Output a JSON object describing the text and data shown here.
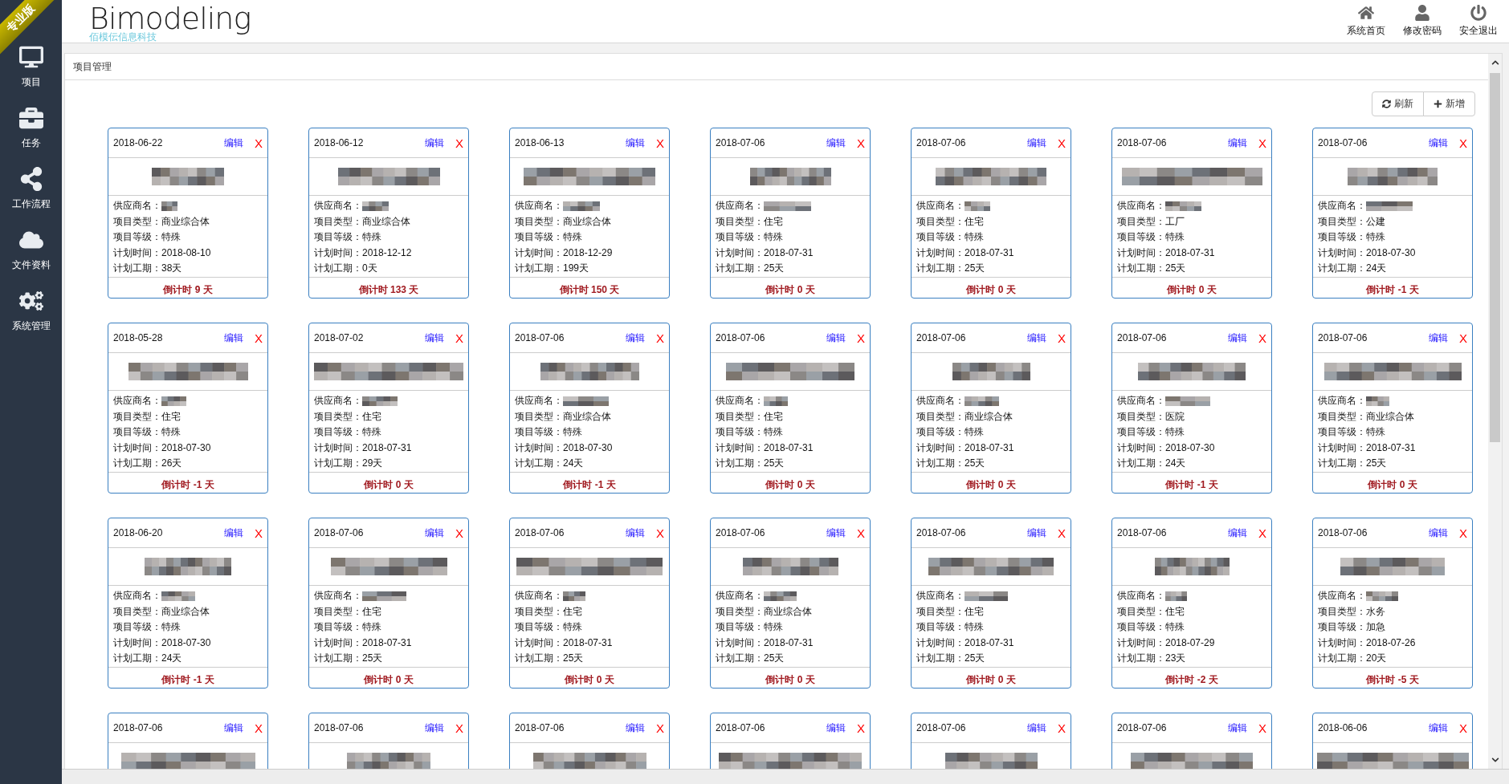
{
  "edition_ribbon": "专业版",
  "logo": {
    "name": "Bimodeling",
    "subtitle": "佰模伝信息科技"
  },
  "sidebar": {
    "items": [
      {
        "label": "项目"
      },
      {
        "label": "任务"
      },
      {
        "label": "工作流程"
      },
      {
        "label": "文件资料"
      },
      {
        "label": "系统管理"
      }
    ]
  },
  "top_nav": [
    {
      "label": "系统首页"
    },
    {
      "label": "修改密码"
    },
    {
      "label": "安全退出"
    }
  ],
  "panel": {
    "title": "项目管理",
    "buttons": [
      {
        "label": "刷新"
      },
      {
        "label": "新增"
      }
    ]
  },
  "cards": [
    {
      "date": "2018-06-22",
      "edit": "编辑",
      "delete": "X",
      "supplier_label": "供应商名：",
      "lines": [
        "项目类型：商业综合体",
        "项目等级：特殊",
        "计划时间：2018-08-10",
        "计划工期：38天"
      ],
      "countdown": "倒计时 9 天"
    },
    {
      "date": "2018-06-12",
      "edit": "编辑",
      "delete": "X",
      "supplier_label": "供应商名：",
      "lines": [
        "项目类型：商业综合体",
        "项目等级：特殊",
        "计划时间：2018-12-12",
        "计划工期：0天"
      ],
      "countdown": "倒计时 133 天"
    },
    {
      "date": "2018-06-13",
      "edit": "编辑",
      "delete": "X",
      "supplier_label": "供应商名：",
      "lines": [
        "项目类型：商业综合体",
        "项目等级：特殊",
        "计划时间：2018-12-29",
        "计划工期：199天"
      ],
      "countdown": "倒计时 150 天"
    },
    {
      "date": "2018-07-06",
      "edit": "编辑",
      "delete": "X",
      "supplier_label": "供应商名：",
      "lines": [
        "项目类型：住宅",
        "项目等级：特殊",
        "计划时间：2018-07-31",
        "计划工期：25天"
      ],
      "countdown": "倒计时 0 天"
    },
    {
      "date": "2018-07-06",
      "edit": "编辑",
      "delete": "X",
      "supplier_label": "供应商名：",
      "lines": [
        "项目类型：住宅",
        "项目等级：特殊",
        "计划时间：2018-07-31",
        "计划工期：25天"
      ],
      "countdown": "倒计时 0 天"
    },
    {
      "date": "2018-07-06",
      "edit": "编辑",
      "delete": "X",
      "supplier_label": "供应商名：",
      "lines": [
        "项目类型：工厂",
        "项目等级：特殊",
        "计划时间：2018-07-31",
        "计划工期：25天"
      ],
      "countdown": "倒计时 0 天"
    },
    {
      "date": "2018-07-06",
      "edit": "编辑",
      "delete": "X",
      "supplier_label": "供应商名：",
      "lines": [
        "项目类型：公建",
        "项目等级：特殊",
        "计划时间：2018-07-30",
        "计划工期：24天"
      ],
      "countdown": "倒计时 -1 天"
    },
    {
      "date": "2018-05-28",
      "edit": "编辑",
      "delete": "X",
      "supplier_label": "供应商名：",
      "lines": [
        "项目类型：住宅",
        "项目等级：特殊",
        "计划时间：2018-07-30",
        "计划工期：26天"
      ],
      "countdown": "倒计时 -1 天"
    },
    {
      "date": "2018-07-02",
      "edit": "编辑",
      "delete": "X",
      "supplier_label": "供应商名：",
      "lines": [
        "项目类型：住宅",
        "项目等级：特殊",
        "计划时间：2018-07-31",
        "计划工期：29天"
      ],
      "countdown": "倒计时 0 天"
    },
    {
      "date": "2018-07-06",
      "edit": "编辑",
      "delete": "X",
      "supplier_label": "供应商名：",
      "lines": [
        "项目类型：商业综合体",
        "项目等级：特殊",
        "计划时间：2018-07-30",
        "计划工期：24天"
      ],
      "countdown": "倒计时 -1 天"
    },
    {
      "date": "2018-07-06",
      "edit": "编辑",
      "delete": "X",
      "supplier_label": "供应商名：",
      "lines": [
        "项目类型：住宅",
        "项目等级：特殊",
        "计划时间：2018-07-31",
        "计划工期：25天"
      ],
      "countdown": "倒计时 0 天"
    },
    {
      "date": "2018-07-06",
      "edit": "编辑",
      "delete": "X",
      "supplier_label": "供应商名：",
      "lines": [
        "项目类型：商业综合体",
        "项目等级：特殊",
        "计划时间：2018-07-31",
        "计划工期：25天"
      ],
      "countdown": "倒计时 0 天"
    },
    {
      "date": "2018-07-06",
      "edit": "编辑",
      "delete": "X",
      "supplier_label": "供应商名：",
      "lines": [
        "项目类型：医院",
        "项目等级：特殊",
        "计划时间：2018-07-30",
        "计划工期：24天"
      ],
      "countdown": "倒计时 -1 天"
    },
    {
      "date": "2018-07-06",
      "edit": "编辑",
      "delete": "X",
      "supplier_label": "供应商名：",
      "lines": [
        "项目类型：商业综合体",
        "项目等级：特殊",
        "计划时间：2018-07-31",
        "计划工期：25天"
      ],
      "countdown": "倒计时 0 天"
    },
    {
      "date": "2018-06-20",
      "edit": "编辑",
      "delete": "X",
      "supplier_label": "供应商名：",
      "lines": [
        "项目类型：商业综合体",
        "项目等级：特殊",
        "计划时间：2018-07-30",
        "计划工期：24天"
      ],
      "countdown": "倒计时 -1 天"
    },
    {
      "date": "2018-07-06",
      "edit": "编辑",
      "delete": "X",
      "supplier_label": "供应商名：",
      "lines": [
        "项目类型：住宅",
        "项目等级：特殊",
        "计划时间：2018-07-31",
        "计划工期：25天"
      ],
      "countdown": "倒计时 0 天"
    },
    {
      "date": "2018-07-06",
      "edit": "编辑",
      "delete": "X",
      "supplier_label": "供应商名：",
      "lines": [
        "项目类型：住宅",
        "项目等级：特殊",
        "计划时间：2018-07-31",
        "计划工期：25天"
      ],
      "countdown": "倒计时 0 天"
    },
    {
      "date": "2018-07-06",
      "edit": "编辑",
      "delete": "X",
      "supplier_label": "供应商名：",
      "lines": [
        "项目类型：商业综合体",
        "项目等级：特殊",
        "计划时间：2018-07-31",
        "计划工期：25天"
      ],
      "countdown": "倒计时 0 天"
    },
    {
      "date": "2018-07-06",
      "edit": "编辑",
      "delete": "X",
      "supplier_label": "供应商名：",
      "lines": [
        "项目类型：住宅",
        "项目等级：特殊",
        "计划时间：2018-07-31",
        "计划工期：25天"
      ],
      "countdown": "倒计时 0 天"
    },
    {
      "date": "2018-07-06",
      "edit": "编辑",
      "delete": "X",
      "supplier_label": "供应商名：",
      "lines": [
        "项目类型：住宅",
        "项目等级：特殊",
        "计划时间：2018-07-29",
        "计划工期：23天"
      ],
      "countdown": "倒计时 -2 天"
    },
    {
      "date": "2018-07-06",
      "edit": "编辑",
      "delete": "X",
      "supplier_label": "供应商名：",
      "lines": [
        "项目类型：水务",
        "项目等级：加急",
        "计划时间：2018-07-26",
        "计划工期：20天"
      ],
      "countdown": "倒计时 -5 天"
    },
    {
      "date": "2018-07-06",
      "edit": "编辑",
      "delete": "X"
    },
    {
      "date": "2018-07-06",
      "edit": "编辑",
      "delete": "X"
    },
    {
      "date": "2018-07-06",
      "edit": "编辑",
      "delete": "X"
    },
    {
      "date": "2018-07-06",
      "edit": "编辑",
      "delete": "X"
    },
    {
      "date": "2018-07-06",
      "edit": "编辑",
      "delete": "X"
    },
    {
      "date": "2018-07-06",
      "edit": "编辑",
      "delete": "X"
    },
    {
      "date": "2018-06-06",
      "edit": "编辑",
      "delete": "X"
    }
  ]
}
